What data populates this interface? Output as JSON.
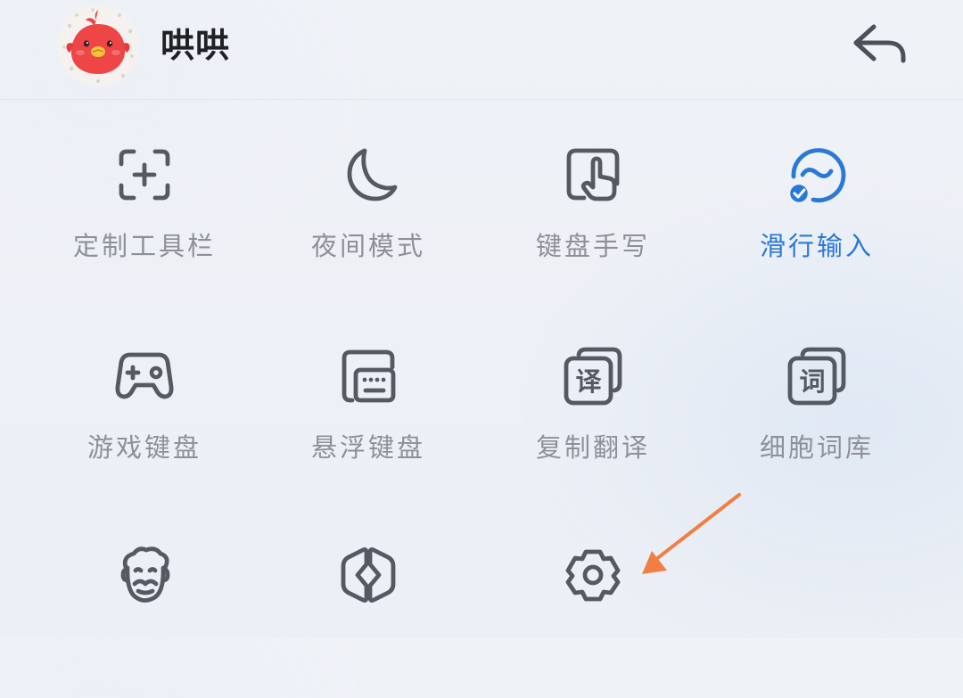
{
  "header": {
    "username": "哄哄",
    "avatar_icon": "red-chick-avatar",
    "back_icon": "back-arrow-icon"
  },
  "toolbar": [
    {
      "label": "定制工具栏",
      "icon": "customize-toolbar-icon",
      "active": false
    },
    {
      "label": "夜间模式",
      "icon": "moon-icon",
      "active": false
    },
    {
      "label": "键盘手写",
      "icon": "handwriting-icon",
      "active": false
    },
    {
      "label": "滑行输入",
      "icon": "swipe-input-icon",
      "active": true
    },
    {
      "label": "游戏键盘",
      "icon": "gamepad-icon",
      "active": false
    },
    {
      "label": "悬浮键盘",
      "icon": "floating-keyboard-icon",
      "active": false
    },
    {
      "label": "复制翻译",
      "icon": "translate-icon",
      "active": false
    },
    {
      "label": "细胞词库",
      "icon": "dictionary-icon",
      "active": false
    },
    {
      "label": "",
      "icon": "elder-mode-icon",
      "active": false
    },
    {
      "label": "",
      "icon": "split-keyboard-icon",
      "active": false
    },
    {
      "label": "",
      "icon": "settings-gear-icon",
      "active": false
    }
  ],
  "annotation": {
    "arrow_icon": "orange-pointer-arrow",
    "arrow_color": "#f07f45"
  },
  "colors": {
    "icon_stroke": "#555962",
    "label_gray": "#8d9098",
    "accent_blue": "#2979d6",
    "username": "#1f1f24"
  }
}
